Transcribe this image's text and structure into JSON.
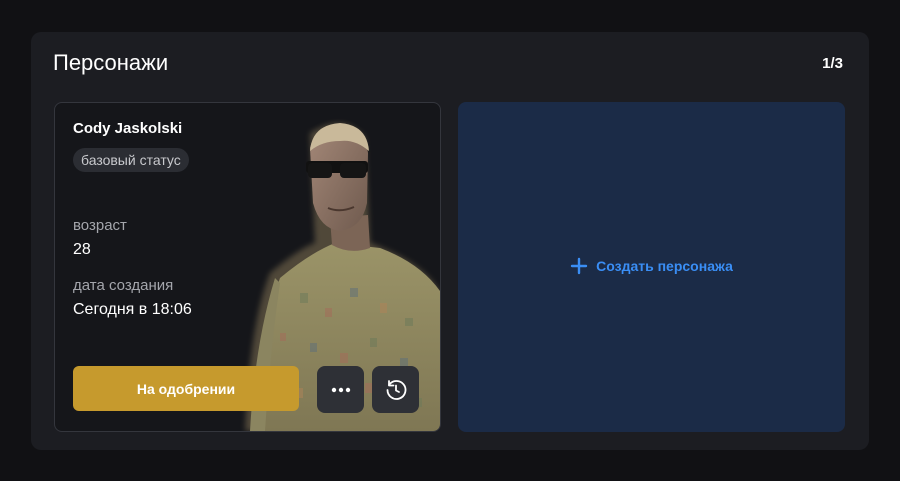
{
  "panel": {
    "title": "Персонажи",
    "counter": "1/3"
  },
  "character": {
    "name": "Cody Jaskolski",
    "status": "базовый статус",
    "age_label": "возраст",
    "age_value": "28",
    "created_label": "дата создания",
    "created_value": "Сегодня в 18:06",
    "approve_label": "На одобрении"
  },
  "create": {
    "label": "Создать персонажа"
  },
  "icons": {
    "more": "more-dots-icon",
    "history": "history-clock-icon",
    "plus": "plus-icon"
  },
  "colors": {
    "accent_gold": "#c69a2d",
    "create_bg": "#1b2b47",
    "create_text": "#3a8ef5"
  }
}
